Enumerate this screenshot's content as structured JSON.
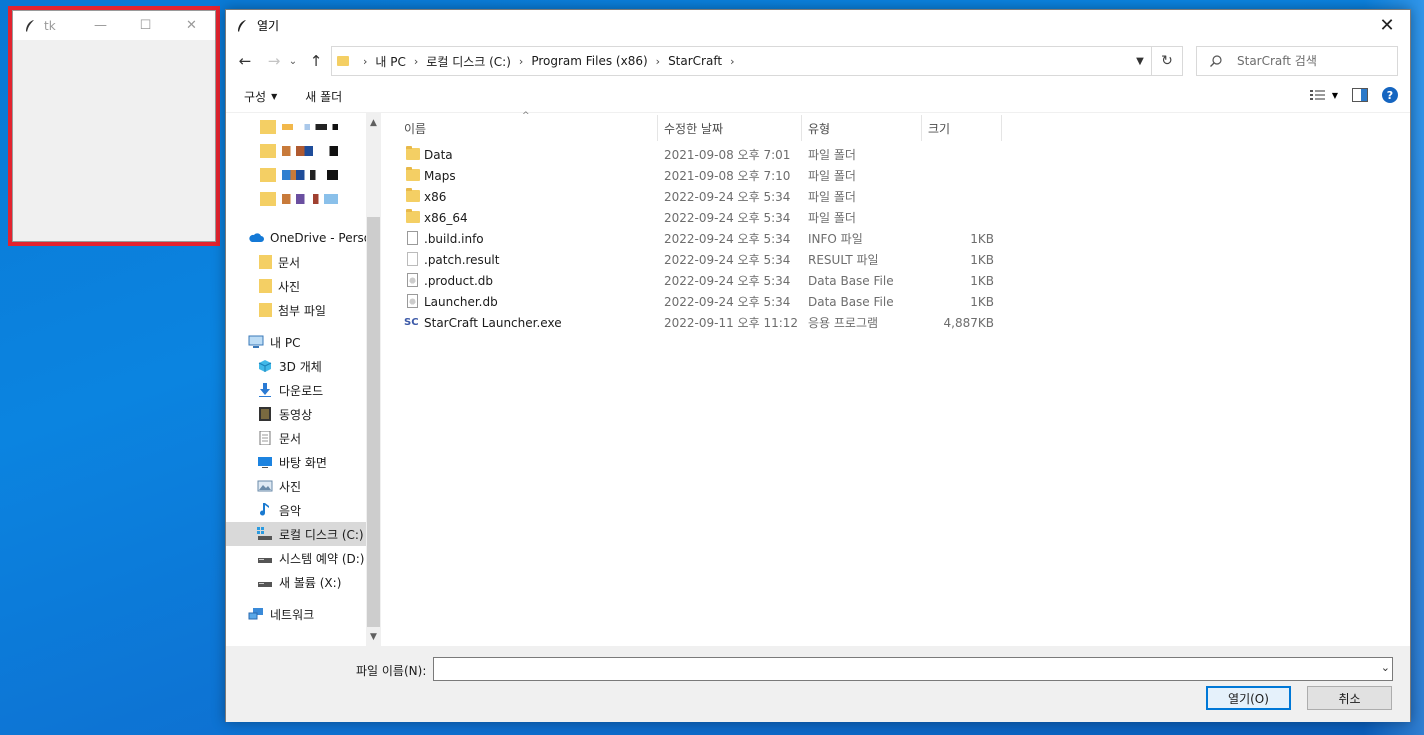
{
  "tk_window": {
    "title": "tk",
    "minimize": "—",
    "maximize": "☐",
    "close": "✕"
  },
  "dialog": {
    "title": "열기",
    "close": "✕"
  },
  "nav": {
    "back": "←",
    "forward": "→",
    "recent": "⌄",
    "up": "↑",
    "breadcrumbs": [
      "내 PC",
      "로컬 디스크 (C:)",
      "Program Files (x86)",
      "StarCraft"
    ],
    "refresh": "↻",
    "search_placeholder": "StarCraft 검색"
  },
  "toolbar": {
    "organize": "구성",
    "new_folder": "새 폴더"
  },
  "navpane": {
    "items": [
      {
        "label": "OneDrive - Persor",
        "icon": "cloud-icon",
        "indent": 0
      },
      {
        "label": "문서",
        "icon": "folder-icon",
        "indent": 1
      },
      {
        "label": "사진",
        "icon": "folder-icon",
        "indent": 1
      },
      {
        "label": "첨부 파일",
        "icon": "folder-icon",
        "indent": 1
      },
      {
        "label": "내 PC",
        "icon": "pc-icon",
        "indent": 0
      },
      {
        "label": "3D 개체",
        "icon": "cube-icon",
        "indent": 1
      },
      {
        "label": "다운로드",
        "icon": "download-icon",
        "indent": 1
      },
      {
        "label": "동영상",
        "icon": "video-icon",
        "indent": 1
      },
      {
        "label": "문서",
        "icon": "document-icon",
        "indent": 1
      },
      {
        "label": "바탕 화면",
        "icon": "desktop-icon",
        "indent": 1
      },
      {
        "label": "사진",
        "icon": "picture-icon",
        "indent": 1
      },
      {
        "label": "음악",
        "icon": "music-icon",
        "indent": 1
      },
      {
        "label": "로컬 디스크 (C:)",
        "icon": "drive-icon",
        "indent": 1
      },
      {
        "label": "시스템 예약 (D:)",
        "icon": "drive-icon",
        "indent": 1
      },
      {
        "label": "새 볼륨 (X:)",
        "icon": "drive-icon",
        "indent": 1
      },
      {
        "label": "네트워크",
        "icon": "network-icon",
        "indent": 0
      }
    ]
  },
  "columns": {
    "name": "이름",
    "date": "수정한 날짜",
    "type": "유형",
    "size": "크기"
  },
  "files": [
    {
      "name": "Data",
      "date": "2021-09-08 오후 7:01",
      "type": "파일 폴더",
      "size": "",
      "icon": "folder-icon"
    },
    {
      "name": "Maps",
      "date": "2021-09-08 오후 7:10",
      "type": "파일 폴더",
      "size": "",
      "icon": "folder-icon"
    },
    {
      "name": "x86",
      "date": "2022-09-24 오후 5:34",
      "type": "파일 폴더",
      "size": "",
      "icon": "folder-icon"
    },
    {
      "name": "x86_64",
      "date": "2022-09-24 오후 5:34",
      "type": "파일 폴더",
      "size": "",
      "icon": "folder-icon"
    },
    {
      "name": ".build.info",
      "date": "2022-09-24 오후 5:34",
      "type": "INFO 파일",
      "size": "1KB",
      "icon": "file-icon"
    },
    {
      "name": ".patch.result",
      "date": "2022-09-24 오후 5:34",
      "type": "RESULT 파일",
      "size": "1KB",
      "icon": "file-icon"
    },
    {
      "name": ".product.db",
      "date": "2022-09-24 오후 5:34",
      "type": "Data Base File",
      "size": "1KB",
      "icon": "db-file-icon"
    },
    {
      "name": "Launcher.db",
      "date": "2022-09-24 오후 5:34",
      "type": "Data Base File",
      "size": "1KB",
      "icon": "db-file-icon"
    },
    {
      "name": "StarCraft Launcher.exe",
      "date": "2022-09-11 오후 11:12",
      "type": "응용 프로그램",
      "size": "4,887KB",
      "icon": "starcraft-icon"
    }
  ],
  "footer": {
    "filename_label": "파일 이름(N):",
    "filename_value": "",
    "open_button": "열기(O)",
    "cancel_button": "취소"
  },
  "colors": {
    "accent": "#0078d7",
    "highlight_border": "#e3232f",
    "folder": "#f4cf64"
  }
}
